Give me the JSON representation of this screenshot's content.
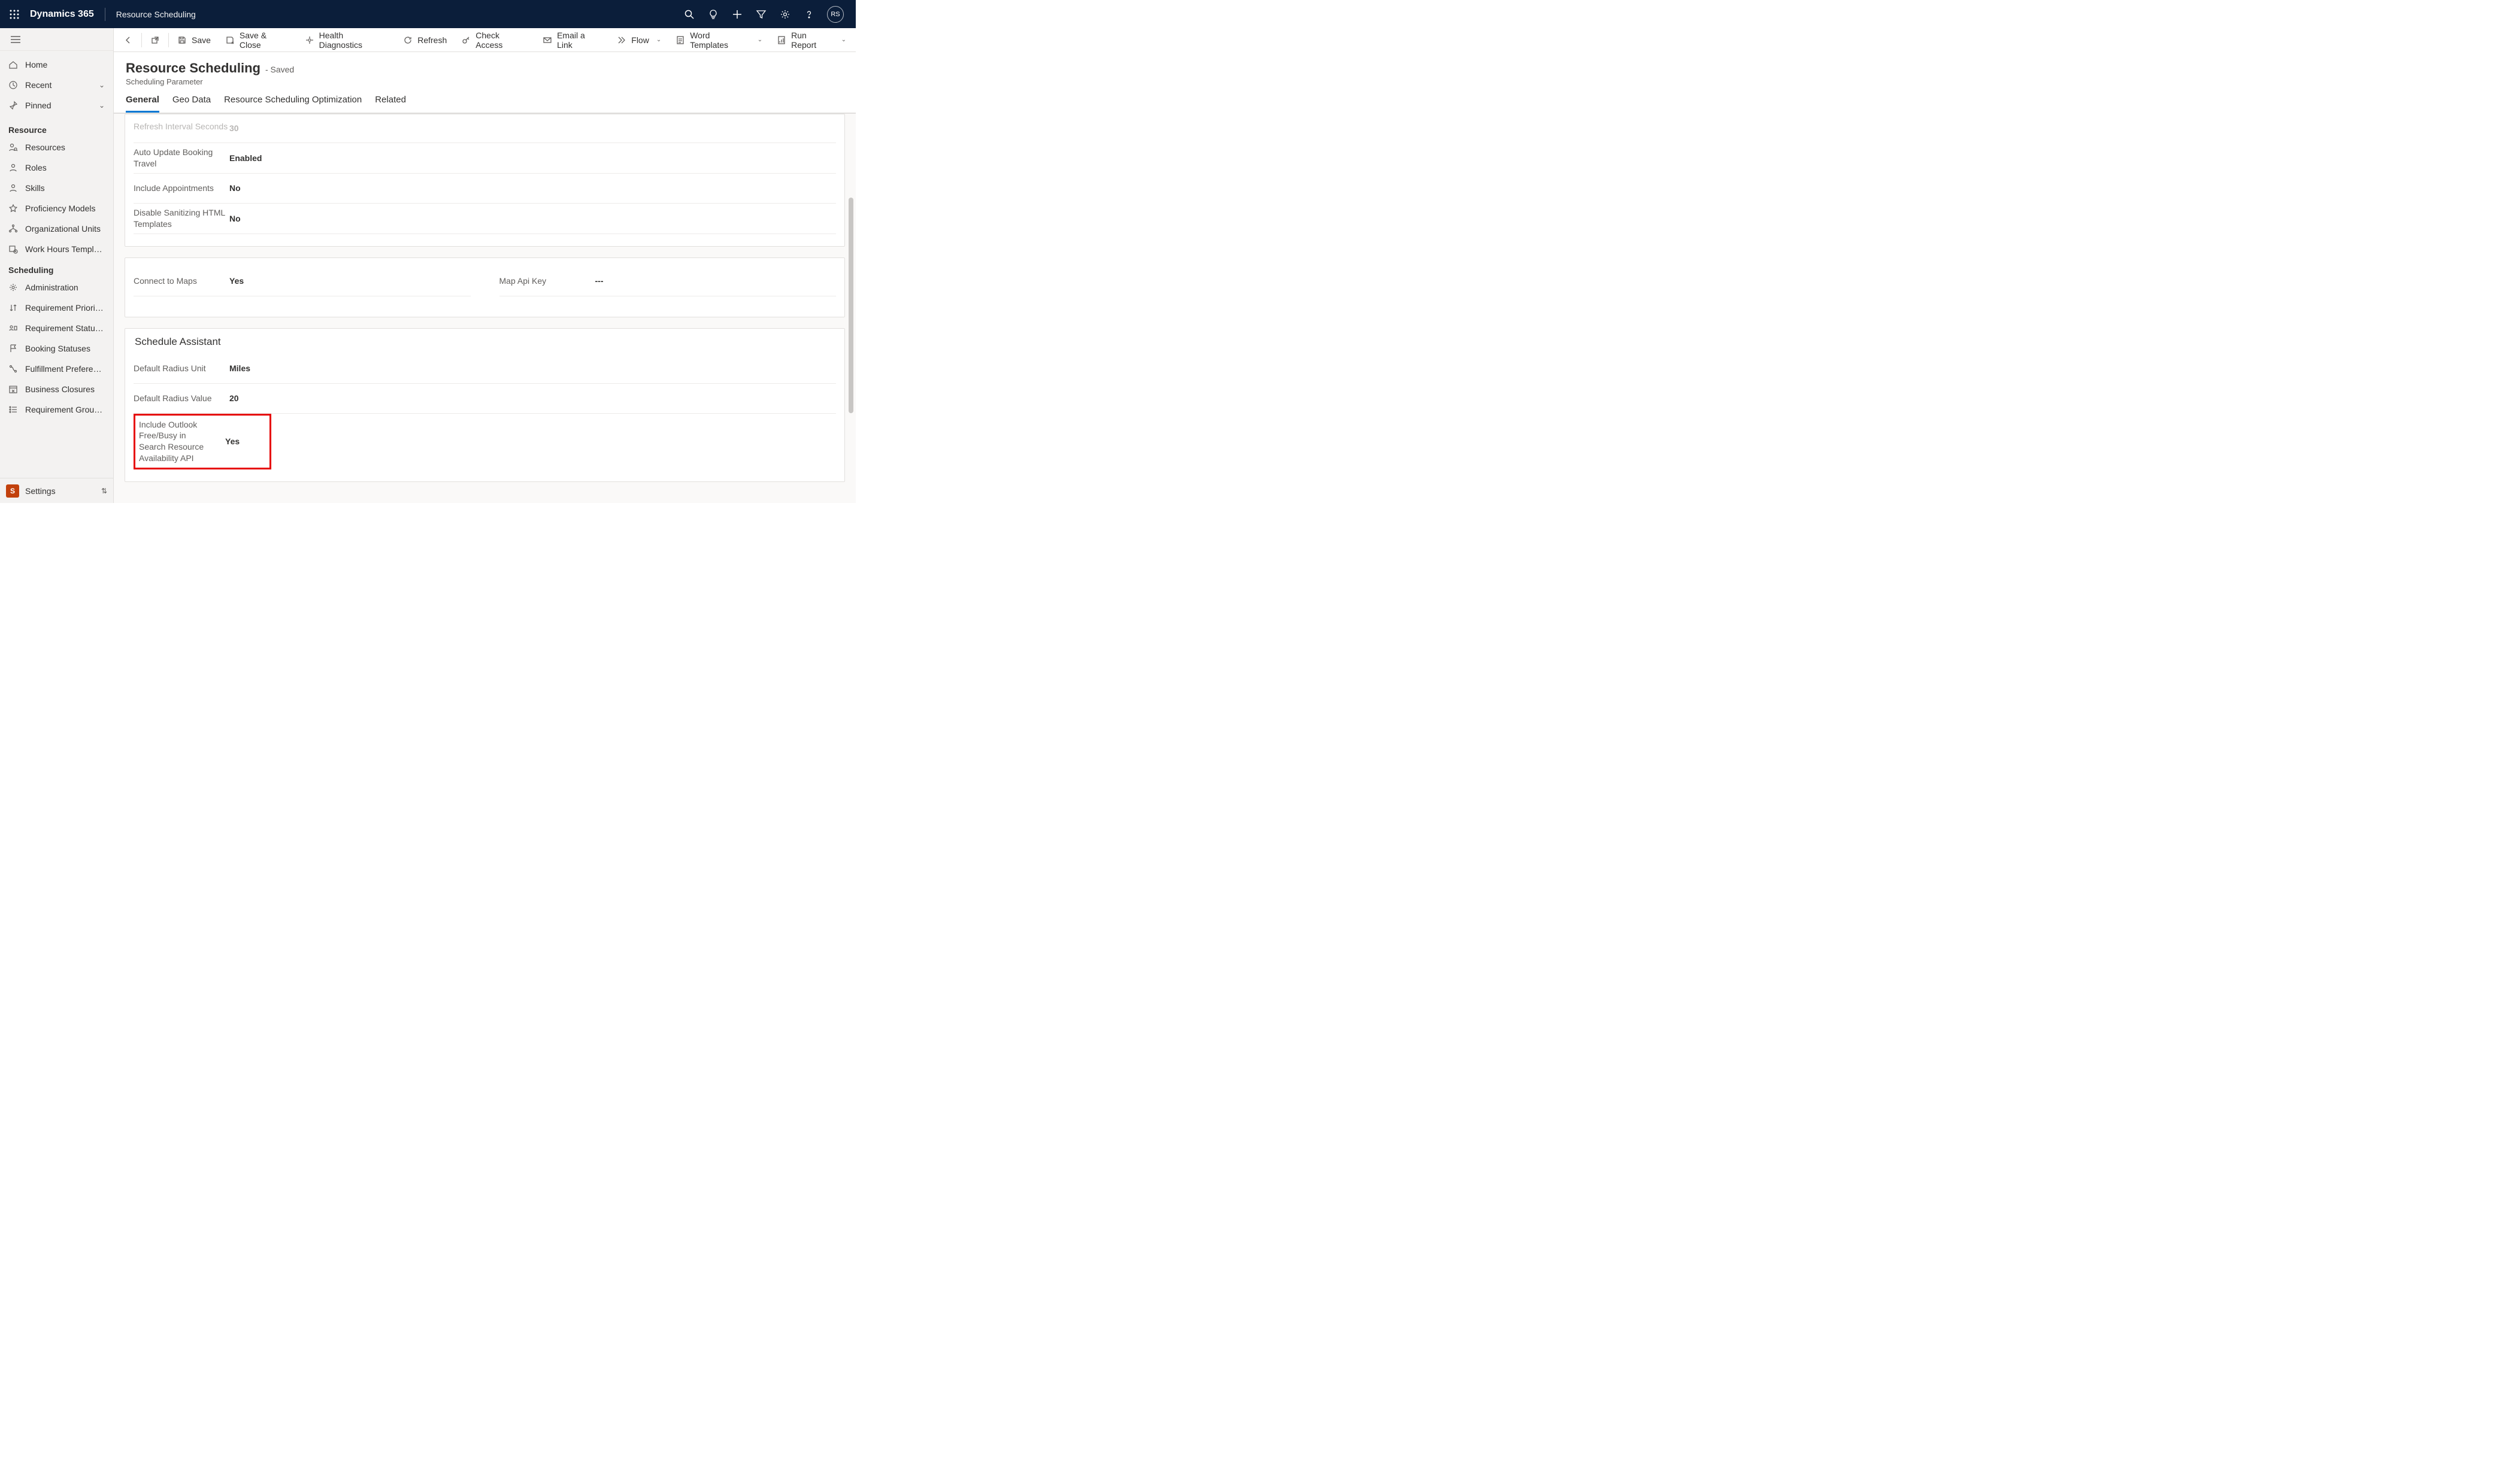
{
  "topbar": {
    "brand": "Dynamics 365",
    "area": "Resource Scheduling",
    "avatar_initials": "RS"
  },
  "nav": {
    "home": "Home",
    "recent": "Recent",
    "pinned": "Pinned",
    "group_resource": "Resource",
    "resources": "Resources",
    "roles": "Roles",
    "skills": "Skills",
    "proficiency": "Proficiency Models",
    "org_units": "Organizational Units",
    "work_hours": "Work Hours Templates",
    "group_scheduling": "Scheduling",
    "administration": "Administration",
    "req_priorities": "Requirement Priorities",
    "req_statuses": "Requirement Statuses",
    "booking_statuses": "Booking Statuses",
    "fulfillment": "Fulfillment Preferences",
    "business_closures": "Business Closures",
    "req_group": "Requirement Group …",
    "footer": "Settings",
    "footer_tile": "S"
  },
  "cmd": {
    "save": "Save",
    "save_close": "Save & Close",
    "health": "Health Diagnostics",
    "refresh": "Refresh",
    "check_access": "Check Access",
    "email": "Email a Link",
    "flow": "Flow",
    "word": "Word Templates",
    "report": "Run Report"
  },
  "header": {
    "title": "Resource Scheduling",
    "state": "- Saved",
    "subtitle": "Scheduling Parameter"
  },
  "tabs": {
    "general": "General",
    "geo": "Geo Data",
    "rso": "Resource Scheduling Optimization",
    "related": "Related"
  },
  "form": {
    "refresh_interval_label": "Refresh Interval Seconds",
    "refresh_interval_value": "30",
    "auto_update_label": "Auto Update Booking Travel",
    "auto_update_value": "Enabled",
    "include_appt_label": "Include Appointments",
    "include_appt_value": "No",
    "disable_html_label": "Disable Sanitizing HTML Templates",
    "disable_html_value": "No",
    "connect_maps_label": "Connect to Maps",
    "connect_maps_value": "Yes",
    "map_key_label": "Map Api Key",
    "map_key_value": "---",
    "sa_section": "Schedule Assistant",
    "radius_unit_label": "Default Radius Unit",
    "radius_unit_value": "Miles",
    "radius_val_label": "Default Radius Value",
    "radius_val_value": "20",
    "outlook_label": "Include Outlook Free/Busy in Search Resource Availability API",
    "outlook_value": "Yes"
  }
}
